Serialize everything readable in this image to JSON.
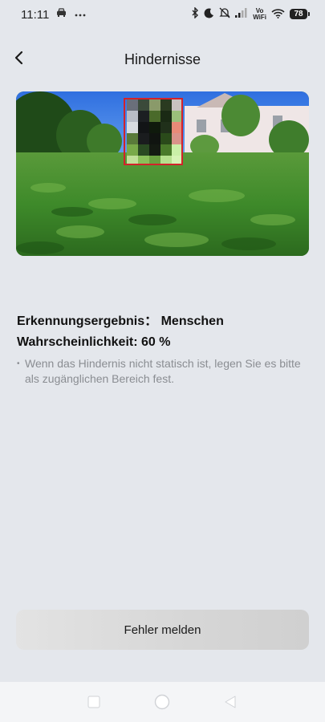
{
  "status_bar": {
    "time": "11:11",
    "wifi_label_top": "Vo",
    "wifi_label_bottom": "WiFi",
    "battery": "78",
    "left_icons": [
      "car-icon",
      "more-dots-icon"
    ],
    "right_icons": [
      "bluetooth-icon",
      "moon-icon",
      "mute-icon",
      "signal-icon",
      "wifi-icon",
      "battery-icon"
    ]
  },
  "header": {
    "title": "Hindernisse"
  },
  "result": {
    "recognition": "Erkennungsergebnis： Menschen",
    "probability": "Wahrscheinlichkeit: 60 %"
  },
  "hint": {
    "bullet": "•",
    "text": "Wenn das Hindernis nicht statisch ist, legen Sie es bitte als zugänglichen Bereich fest."
  },
  "actions": {
    "report_label": "Fehler melden"
  },
  "colors": {
    "background": "#e4e7ec",
    "detection_box": "#d3222a",
    "hint_text": "#8a8d92"
  }
}
